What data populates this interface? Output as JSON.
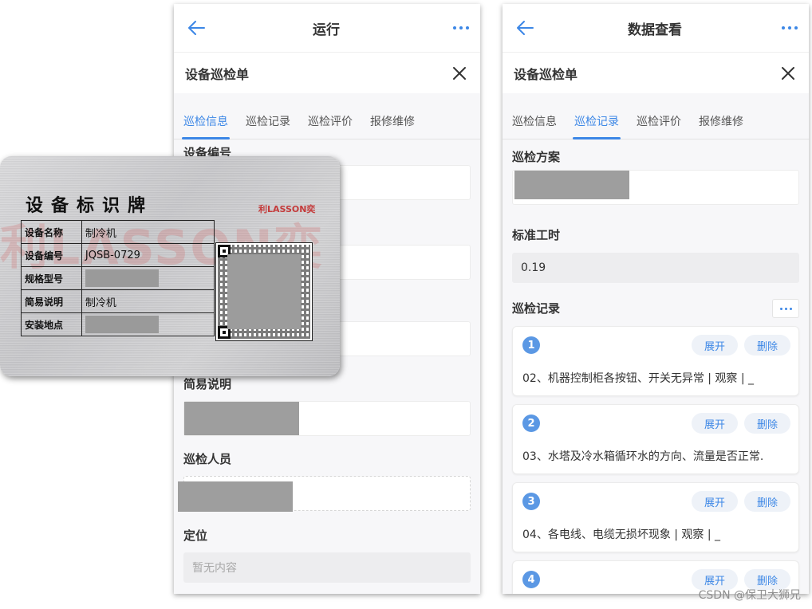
{
  "left_phone": {
    "title": "运行",
    "subtitle": "设备巡检单",
    "tabs": [
      "巡检信息",
      "巡检记录",
      "巡检评价",
      "报修维修"
    ],
    "active_tab": 0,
    "fields": {
      "device_number_label": "设备编号",
      "description_label": "简易说明",
      "inspector_label": "巡检人员",
      "location_label": "定位",
      "location_placeholder": "暂无内容"
    }
  },
  "right_phone": {
    "title": "数据查看",
    "subtitle": "设备巡检单",
    "tabs": [
      "巡检信息",
      "巡检记录",
      "巡检评价",
      "报修维修"
    ],
    "active_tab": 1,
    "plan_label": "巡检方案",
    "standard_hours_label": "标准工时",
    "standard_hours_value": "0.19",
    "records_label": "巡检记录",
    "expand_label": "展开",
    "delete_label": "删除",
    "records": [
      {
        "num": "1",
        "text": "02、机器控制柜各按钮、开关无异常 | 观察 | _"
      },
      {
        "num": "2",
        "text": "03、水塔及冷水箱循环水的方向、流量是否正常."
      },
      {
        "num": "3",
        "text": "04、各电线、电缆无损坏现象 | 观察 | _"
      },
      {
        "num": "4",
        "text": ""
      }
    ]
  },
  "id_card": {
    "title": "设备标识牌",
    "brand": "利LASSON奕",
    "watermark": "利LASSON奕",
    "rows": [
      {
        "key": "设备名称",
        "value": "制冷机"
      },
      {
        "key": "设备编号",
        "value": "JQSB-0729"
      },
      {
        "key": "规格型号",
        "value": ""
      },
      {
        "key": "简易说明",
        "value": "制冷机"
      },
      {
        "key": "安装地点",
        "value": ""
      }
    ]
  },
  "watermark": "CSDN @保卫大狮兄",
  "colors": {
    "accent": "#3c87e6",
    "record_badge": "#5b98e4",
    "redaction": "#9e9e9e"
  }
}
